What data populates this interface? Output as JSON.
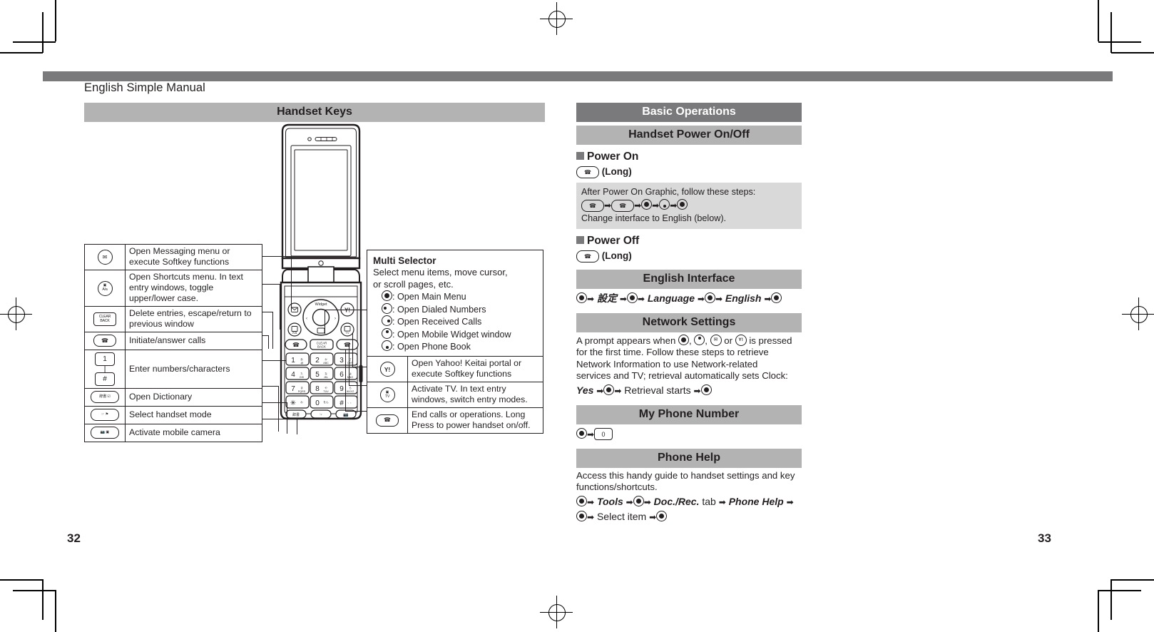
{
  "document": {
    "manual_title": "English Simple Manual",
    "page_left": "32",
    "page_right": "33"
  },
  "left_column": {
    "section_title": "Handset Keys",
    "key_table_left": [
      {
        "icon": "mail-key-icon",
        "desc": "Open Messaging menu or execute Softkey functions"
      },
      {
        "icon": "shortcuts-key-icon",
        "desc": "Open Shortcuts menu. In text entry windows, toggle upper/lower case."
      },
      {
        "icon": "clear-back-key-icon",
        "desc": "Delete entries, escape/return to previous window"
      },
      {
        "icon": "send-call-key-icon",
        "desc": "Initiate/answer calls"
      },
      {
        "icon": "number-keys-icon",
        "desc": "Enter numbers/characters"
      },
      {
        "icon": "dictionary-key-icon",
        "desc": "Open Dictionary"
      },
      {
        "icon": "manner-mode-key-icon",
        "desc": "Select handset mode"
      },
      {
        "icon": "camera-key-icon",
        "desc": "Activate mobile camera"
      }
    ],
    "multi_selector": {
      "title": "Multi Selector",
      "line1": "Select menu items, move cursor,",
      "line2": "or scroll pages, etc.",
      "items": [
        {
          "icon": "center-key-icon",
          "label": ": Open Main Menu"
        },
        {
          "icon": "left-key-icon",
          "label": ": Open Dialed Numbers"
        },
        {
          "icon": "right-key-icon",
          "label": ": Open Received Calls"
        },
        {
          "icon": "up-key-icon",
          "label": ": Open Mobile Widget window"
        },
        {
          "icon": "down-key-icon",
          "label": ": Open Phone Book"
        }
      ]
    },
    "key_table_right": [
      {
        "icon": "yahoo-key-icon",
        "desc": "Open Yahoo! Keitai portal or execute Softkey functions"
      },
      {
        "icon": "tv-key-icon",
        "desc": "Activate TV. In text entry windows, switch entry modes."
      },
      {
        "icon": "end-power-key-icon",
        "desc": "End calls or operations. Long Press to power handset on/off."
      }
    ],
    "keypad_labels": [
      [
        "1",
        "2",
        "3"
      ],
      [
        "4",
        "5",
        "6"
      ],
      [
        "7",
        "8",
        "9"
      ],
      [
        "✳",
        "0",
        "#"
      ]
    ],
    "keypad_sublabels": [
      [
        "あ",
        "か ABC",
        "さ DEF"
      ],
      [
        "た GHI",
        "な JKL",
        "は MNO"
      ],
      [
        "ま PQRS",
        "や TUV",
        "ら WXYZ"
      ],
      [
        "わ",
        "わをん",
        "、。"
      ]
    ]
  },
  "right_column": {
    "section_title": "Basic Operations",
    "blocks": [
      {
        "heading": "Handset Power On/Off",
        "power_on_label": "Power On",
        "power_on_step": "(Long)",
        "note_line1": "After Power On Graphic, follow these steps:",
        "note_line3": "Change interface to English (below).",
        "power_off_label": "Power Off",
        "power_off_step": "(Long)"
      },
      {
        "heading": "English Interface",
        "step_setting": "設定",
        "step_language": "Language",
        "step_english": "English"
      },
      {
        "heading": "Network Settings",
        "body_a": "A prompt appears when ",
        "body_b": " or ",
        "body_c": " is pressed",
        "body_line2": "for the first time. Follow these steps to retrieve",
        "body_line3": "Network Information to use Network-related",
        "body_line4": "services and TV; retrieval automatically sets Clock:",
        "step_yes": "Yes",
        "step_retrieval": "Retrieval starts"
      },
      {
        "heading": "My Phone Number"
      },
      {
        "heading": "Phone Help",
        "body_line1": "Access this handy guide to handset settings and key",
        "body_line2": "functions/shortcuts.",
        "step_tools": "Tools",
        "step_docrec": "Doc./Rec.",
        "step_tab": "tab",
        "step_phonehelp": "Phone Help",
        "step_select": "Select item"
      }
    ]
  },
  "colors": {
    "band_dark": "#7a7a7c",
    "band_light": "#b3b3b3",
    "note_bg": "#d9d9d9",
    "ink": "#231f20"
  }
}
